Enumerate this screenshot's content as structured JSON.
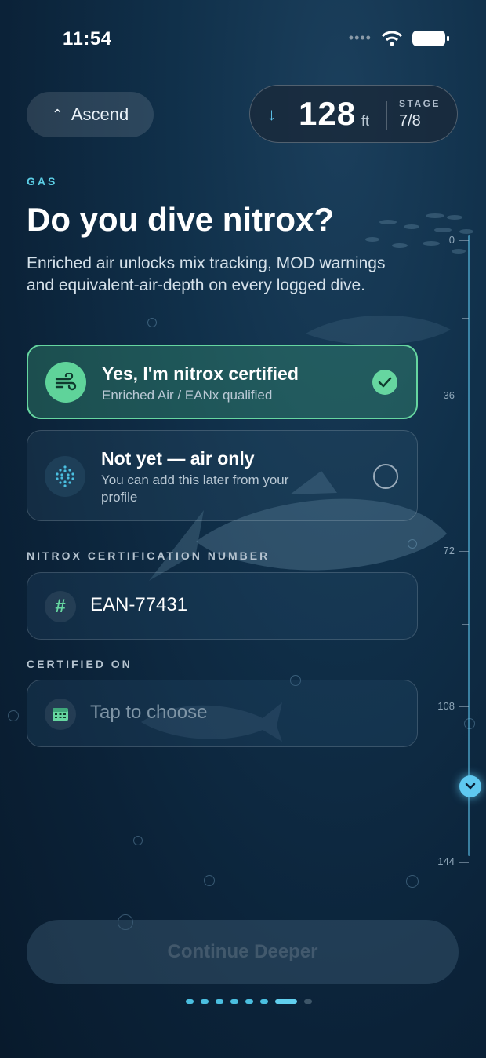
{
  "status": {
    "time": "11:54"
  },
  "nav": {
    "ascend_label": "Ascend"
  },
  "depth": {
    "value": "128",
    "unit": "ft",
    "stage_label": "STAGE",
    "stage_value": "7/8"
  },
  "section_label": "GAS",
  "title": "Do you dive nitrox?",
  "subtitle": "Enriched air unlocks mix tracking, MOD warnings and equivalent-air-depth on every logged dive.",
  "options": [
    {
      "title": "Yes, I'm nitrox certified",
      "subtitle": "Enriched Air / EANx qualified",
      "selected": true
    },
    {
      "title": "Not yet — air only",
      "subtitle": "You can add this later from your profile",
      "selected": false
    }
  ],
  "cert_number": {
    "label": "NITROX CERTIFICATION NUMBER",
    "value": "EAN-77431"
  },
  "cert_date": {
    "label": "CERTIFIED ON",
    "placeholder": "Tap to choose"
  },
  "continue_label": "Continue Deeper",
  "gauge": {
    "ticks": [
      "0",
      "36",
      "72",
      "108",
      "144"
    ]
  },
  "progress": {
    "total": 8,
    "current": 7
  },
  "colors": {
    "accent": "#5fc8f0",
    "success": "#66d6a0",
    "section": "#5ccfe6"
  }
}
